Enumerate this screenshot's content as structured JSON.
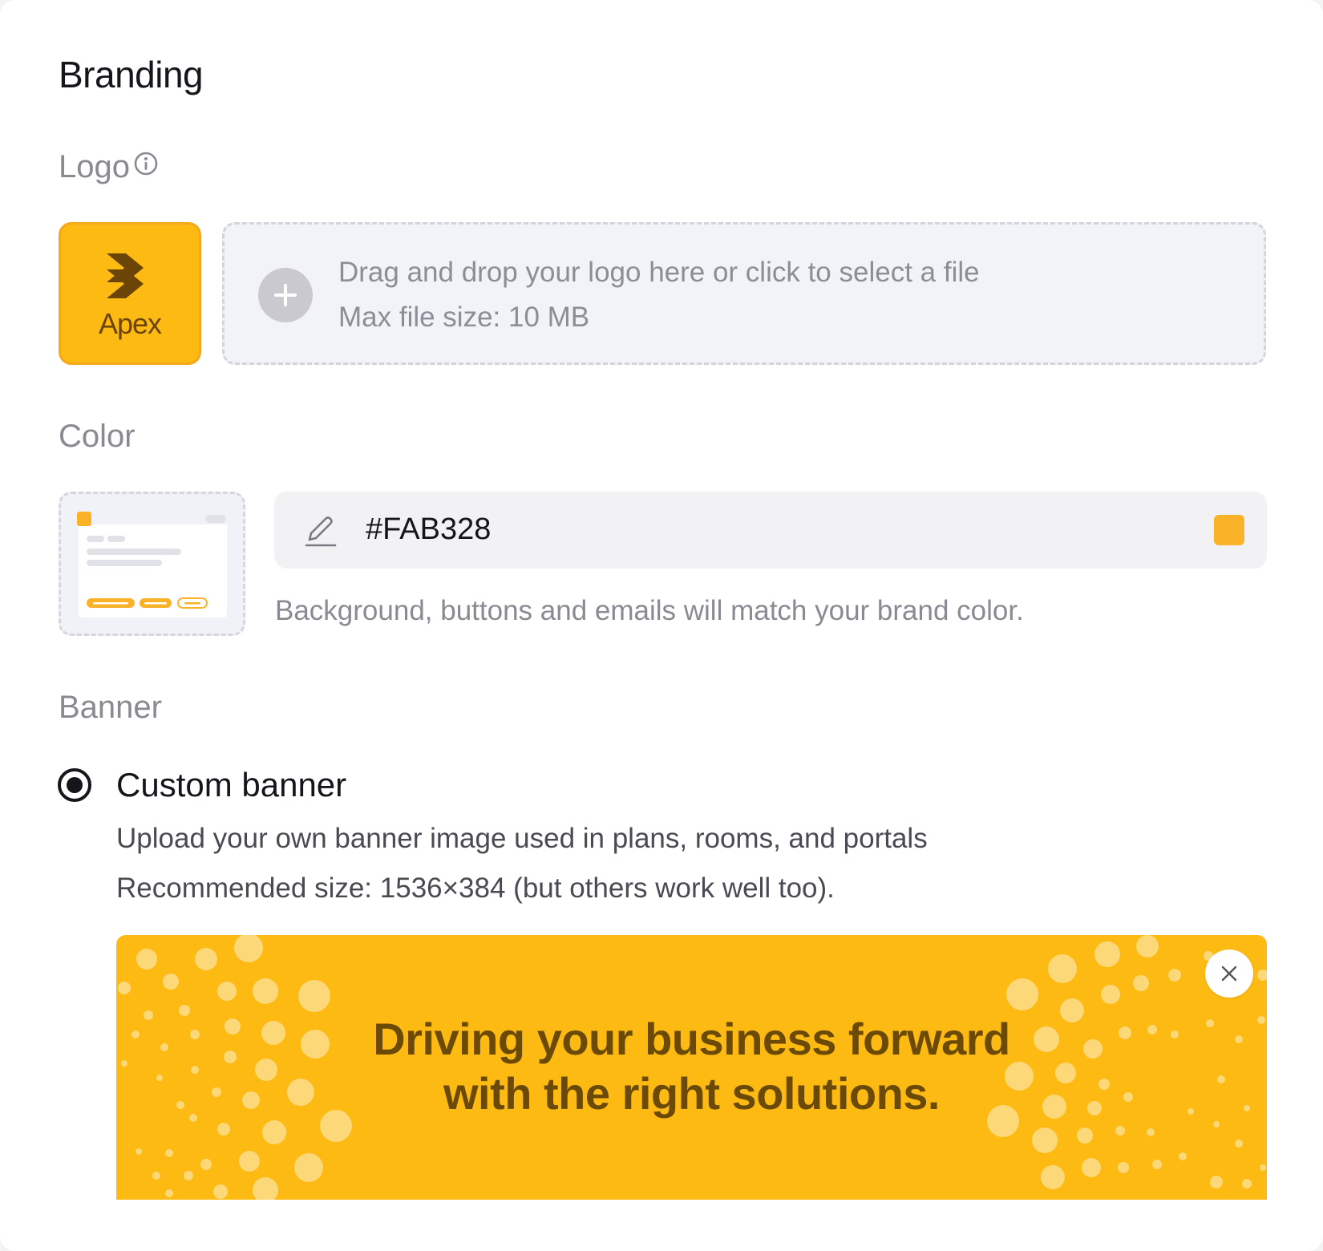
{
  "page": {
    "title": "Branding"
  },
  "logo": {
    "label": "Logo",
    "tile_name": "Apex",
    "dropzone": {
      "primary_text": "Drag and drop your logo here or click to select a file",
      "secondary_text": "Max file size: 10 MB"
    }
  },
  "color": {
    "label": "Color",
    "hex_value": "#FAB328",
    "swatch_color": "#FAB328",
    "help_text": "Background, buttons and emails will match your brand color."
  },
  "banner": {
    "label": "Banner",
    "option_label": "Custom banner",
    "option_selected": true,
    "description": "Upload your own banner image used in plans, rooms, and portals",
    "recommended": "Recommended size: 1536×384 (but others work well too).",
    "image_line1": "Driving your business forward",
    "image_line2": "with the right solutions."
  },
  "colors": {
    "brand": "#FAB328",
    "banner_bg": "#FDBA12",
    "banner_text": "#6B4A07"
  },
  "icons": [
    "info-icon",
    "chevrons-right-icon",
    "plus-icon",
    "pencil-icon",
    "close-icon"
  ]
}
